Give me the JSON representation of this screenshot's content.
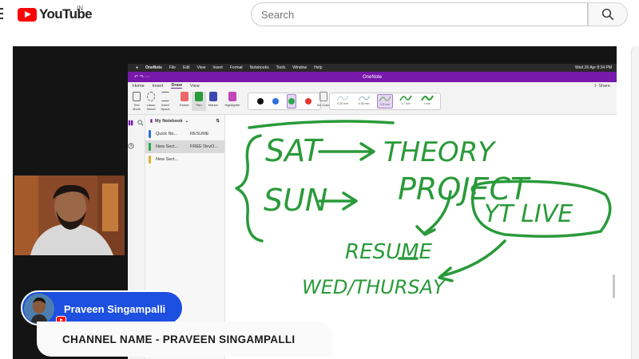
{
  "youtube": {
    "logo_text": "YouTube",
    "country_code": "IN",
    "search_placeholder": "Search"
  },
  "mac_menubar": {
    "app_name": "OneNote",
    "items": [
      "File",
      "Edit",
      "View",
      "Insert",
      "Format",
      "Notebooks",
      "Tools",
      "Window",
      "Help"
    ],
    "clock": "Wed 26 Apr 8:34 PM"
  },
  "onenote": {
    "window_title": "OneNote",
    "tabs": [
      "Home",
      "Insert",
      "Draw",
      "View"
    ],
    "active_tab": "Draw",
    "share_label": "Share",
    "ribbon_tools": [
      {
        "label": "Text Mode"
      },
      {
        "label": "Lasso Select"
      },
      {
        "label": "Insert Space"
      },
      {
        "label": "Eraser"
      },
      {
        "label": "Pen"
      },
      {
        "label": "Marker"
      },
      {
        "label": "Highlighter"
      }
    ],
    "ink_color_label": "Ink Color",
    "pen_colors": [
      "#111111",
      "#2f6fe0",
      "#2aa84a",
      "#e03a2e"
    ],
    "stroke_sizes": [
      "0.25 mm",
      "0.35 mm",
      "0.5 mm",
      "0.7 mm",
      "1 mm"
    ],
    "selected_stroke": "0.5 mm",
    "notebook_name": "My Notebook",
    "sections": [
      {
        "name": "Quick No...",
        "page": "RESUME",
        "color": "#2f6fe0"
      },
      {
        "name": "New Sect...",
        "page": "FREE DevO...",
        "color": "#2aa84a"
      },
      {
        "name": "New Sect...",
        "page": "",
        "color": "#e0b12a"
      }
    ],
    "ink_color": "#2a9a3a",
    "handwriting": {
      "line1_left": "SAT",
      "line1_right": "THEORY",
      "line2_left": "SUN",
      "line2_right": "PROJECT",
      "circled": "YT LIVE",
      "resume": "RESUME",
      "days": "WED/THURSAY"
    }
  },
  "overlay": {
    "presenter_name": "Praveen Singampalli",
    "channel_banner": "CHANNEL NAME - PRAVEEN SINGAMPALLI"
  }
}
